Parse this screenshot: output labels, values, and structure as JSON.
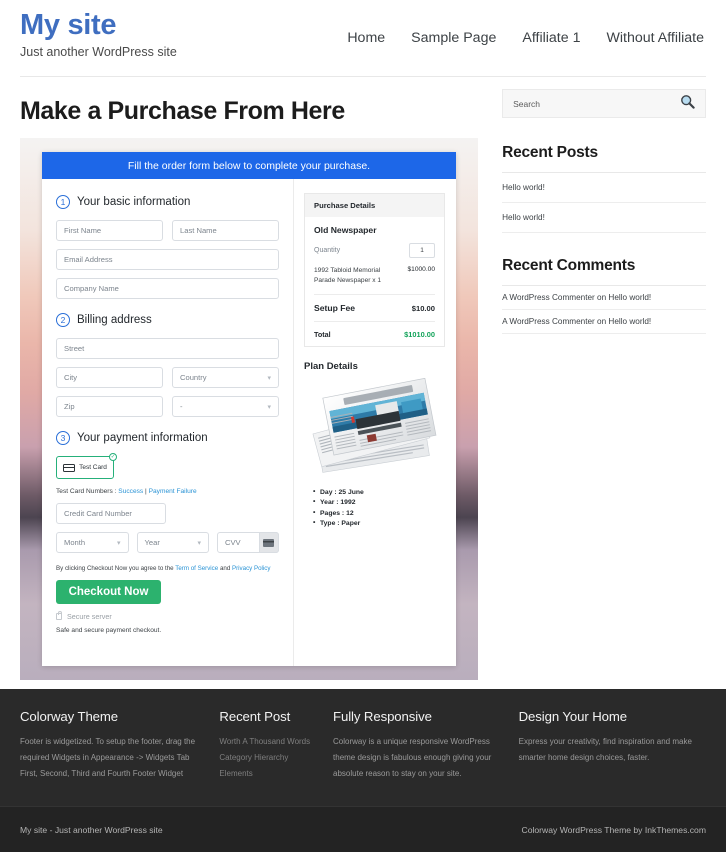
{
  "header": {
    "brand_title": "My site",
    "brand_tagline": "Just another WordPress site",
    "nav": [
      {
        "label": "Home"
      },
      {
        "label": "Sample Page"
      },
      {
        "label": "Affiliate 1"
      },
      {
        "label": "Without Affiliate"
      }
    ]
  },
  "main": {
    "page_title": "Make a Purchase From Here",
    "form_banner": "Fill the order form below to complete your purchase.",
    "step1": {
      "number": "1",
      "label": "Your basic information",
      "first_name_placeholder": "First Name",
      "last_name_placeholder": "Last Name",
      "email_placeholder": "Email Address",
      "company_placeholder": "Company Name"
    },
    "step2": {
      "number": "2",
      "label": "Billing address",
      "street_placeholder": "Street",
      "city_placeholder": "City",
      "country_placeholder": "Country",
      "zip_placeholder": "Zip",
      "state_placeholder": "-"
    },
    "step3": {
      "number": "3",
      "label": "Your payment information",
      "card_option_label": "Test  Card",
      "check_glyph": "✓",
      "test_card_prefix": "Test Card Numbers : ",
      "test_card_success": "Success",
      "test_card_separator": " | ",
      "test_card_failure": "Payment Failure",
      "card_number_placeholder": "Credit Card Number",
      "month_placeholder": "Month",
      "year_placeholder": "Year",
      "cvv_placeholder": "CVV",
      "agree_prefix": "By clicking Checkout Now you agree to the ",
      "agree_tos": "Term of Service",
      "agree_and": " and ",
      "agree_privacy": "Privacy Policy",
      "checkout_label": "Checkout Now",
      "secure_server": "Secure server",
      "safe_note": "Safe and secure payment checkout."
    },
    "purchase_details": {
      "heading": "Purchase Details",
      "product": "Old Newspaper",
      "quantity_label": "Quantity",
      "quantity_value": "1",
      "item_name": "1992 Tabloid Memorial Parade Newspaper x 1",
      "item_price": "$1000.00",
      "setup_fee_label": "Setup Fee",
      "setup_fee_value": "$10.00",
      "total_label": "Total",
      "total_value": "$1010.00"
    },
    "plan_details": {
      "heading": "Plan Details",
      "items": [
        "Day : 25 June",
        "Year : 1992",
        "Pages : 12",
        "Type : Paper"
      ]
    }
  },
  "sidebar": {
    "search_placeholder": "Search",
    "search_icon": "search-icon",
    "recent_posts": {
      "title": "Recent Posts",
      "items": [
        "Hello world!",
        "Hello world!"
      ]
    },
    "recent_comments": {
      "title": "Recent Comments",
      "items": [
        "A WordPress Commenter on Hello world!",
        "A WordPress Commenter on Hello world!"
      ]
    }
  },
  "footer": {
    "columns": [
      {
        "title": "Colorway Theme",
        "text": "Footer is widgetized. To setup the footer, drag the required Widgets in Appearance -> Widgets Tab First, Second, Third and Fourth Footer Widget"
      },
      {
        "title": "Recent Post",
        "list": [
          "Worth A Thousand Words",
          "Category Hierarchy",
          "Elements"
        ]
      },
      {
        "title": "Fully Responsive",
        "text": "Colorway is a unique responsive WordPress theme design is fabulous enough giving your absolute reason to stay on your site."
      },
      {
        "title": "Design Your Home",
        "text": "Express your creativity, find inspiration and make smarter home design choices, faster."
      }
    ],
    "bottom_left": "My site - Just another WordPress site",
    "bottom_right": "Colorway WordPress Theme by InkThemes.com"
  },
  "colors": {
    "brand_blue": "#3f6ec0",
    "banner_blue": "#1d67e8",
    "checkout_green": "#2cb26e",
    "total_green": "#13a35a",
    "link_blue": "#2a93d5",
    "footer_dark": "#2a2a2a",
    "footer_bottom": "#232323"
  }
}
